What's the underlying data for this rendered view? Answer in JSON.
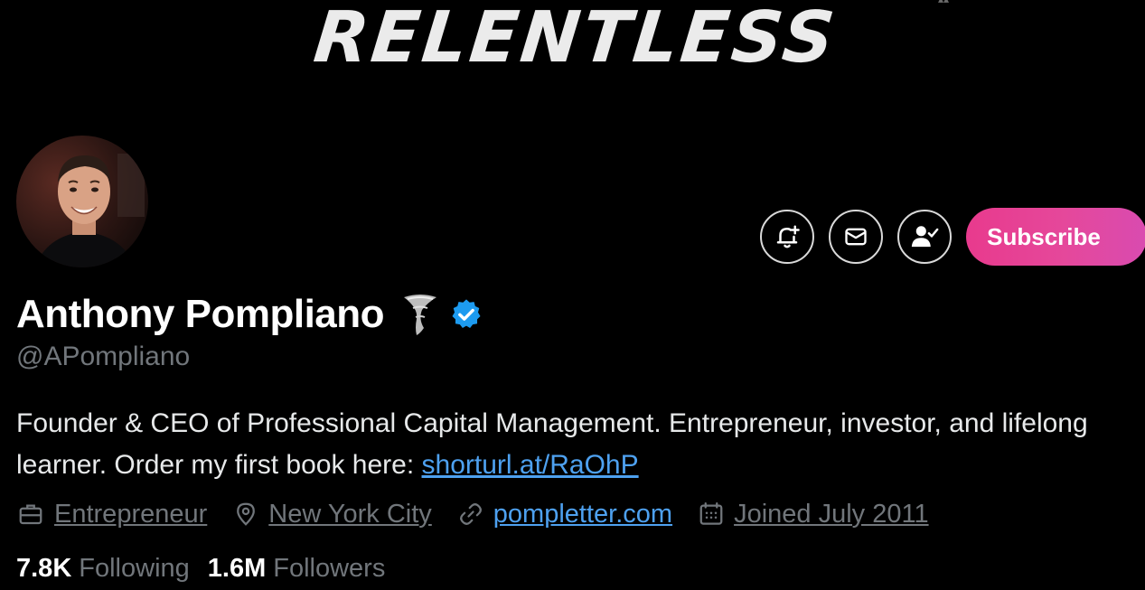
{
  "banner": {
    "text": "RELENTLESS"
  },
  "profile": {
    "display_name": "Anthony Pompliano",
    "handle": "@APompliano",
    "bio_text": "Founder & CEO of Professional Capital Management. Entrepreneur, investor, and lifelong learner. Order my first book here: ",
    "bio_link": "shorturl.at/RaOhP",
    "verified": true
  },
  "actions": {
    "subscribe_label": "Subscribe",
    "notify_icon": "bell-plus-icon",
    "message_icon": "envelope-icon",
    "follow_icon": "person-check-icon"
  },
  "meta": {
    "profession": "Entrepreneur",
    "location": "New York City",
    "website": "pompletter.com",
    "joined": "Joined July 2011"
  },
  "stats": {
    "following_count": "7.8K",
    "following_label": "Following",
    "followers_count": "1.6M",
    "followers_label": "Followers"
  },
  "colors": {
    "background": "#000000",
    "link": "#4ea1f0",
    "muted": "#71767b",
    "subscribe_gradient_start": "#e83a8d",
    "subscribe_gradient_end": "#d94bb0",
    "verified": "#1d9bf0"
  }
}
